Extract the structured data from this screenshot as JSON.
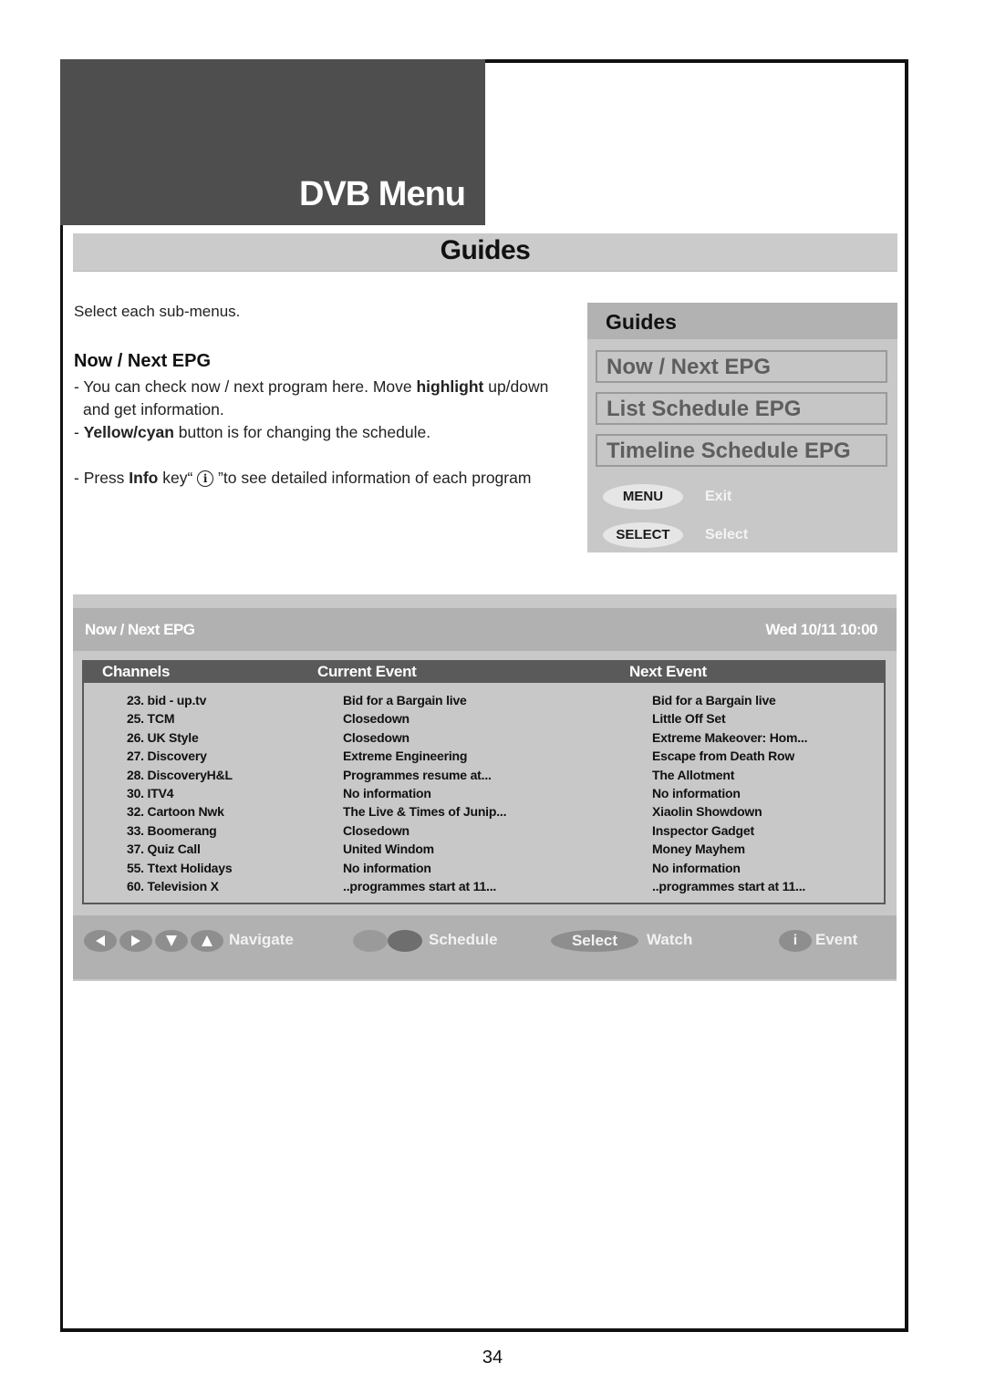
{
  "header": {
    "title": "DVB Menu"
  },
  "section": {
    "title": "Guides"
  },
  "intro": "Select each sub-menus.",
  "subsection": {
    "heading": "Now / Next EPG",
    "bullets": [
      {
        "pre": "- You can check now / next program here. Move ",
        "bold": "highlight",
        "post": " up/down"
      },
      {
        "pre": "and get information.",
        "bold": "",
        "post": ""
      },
      {
        "pre": "- ",
        "bold": "Yellow/cyan",
        "post": " button is for changing the schedule."
      },
      {
        "pre": "- Press ",
        "bold": "Info",
        "post_a": " key“ ",
        "icon": "i",
        "post_b": " ”to see detailed information of each program"
      }
    ]
  },
  "guides_menu": {
    "title": "Guides",
    "options": [
      "Now / Next EPG",
      "List Schedule EPG",
      "Timeline Schedule EPG"
    ],
    "hints": [
      {
        "key": "MENU",
        "label": "Exit"
      },
      {
        "key": "SELECT",
        "label": "Select"
      }
    ]
  },
  "epg": {
    "title": "Now / Next EPG",
    "datetime": "Wed 10/11 10:00",
    "columns": [
      "Channels",
      "Current Event",
      "Next Event"
    ],
    "rows": [
      {
        "channel": "23. bid - up.tv",
        "current": "Bid for a Bargain live",
        "next": "Bid for a Bargain live"
      },
      {
        "channel": "25. TCM",
        "current": "Closedown",
        "next": "Little Off Set"
      },
      {
        "channel": "26. UK Style",
        "current": "Closedown",
        "next": "Extreme Makeover: Hom..."
      },
      {
        "channel": "27. Discovery",
        "current": "Extreme Engineering",
        "next": "Escape from Death Row"
      },
      {
        "channel": "28. DiscoveryH&L",
        "current": "Programmes resume at...",
        "next": "The Allotment"
      },
      {
        "channel": "30. ITV4",
        "current": "No information",
        "next": "No information"
      },
      {
        "channel": "32. Cartoon Nwk",
        "current": "The Live & Times of Junip...",
        "next": "Xiaolin Showdown"
      },
      {
        "channel": "33. Boomerang",
        "current": "Closedown",
        "next": "Inspector Gadget"
      },
      {
        "channel": "37. Quiz Call",
        "current": "United Windom",
        "next": "Money Mayhem"
      },
      {
        "channel": "55. Ttext Holidays",
        "current": "No information",
        "next": "No information"
      },
      {
        "channel": "60. Television X",
        "current": "..programmes start at 11...",
        "next": "..programmes start at 11..."
      }
    ],
    "footer": {
      "navigate": "Navigate",
      "schedule": "Schedule",
      "select_key": "Select",
      "watch": "Watch",
      "info_key": "i",
      "event": "Event",
      "schedule_colors": [
        "#9a9a9a",
        "#6e6e6e"
      ]
    }
  },
  "page_number": "34"
}
